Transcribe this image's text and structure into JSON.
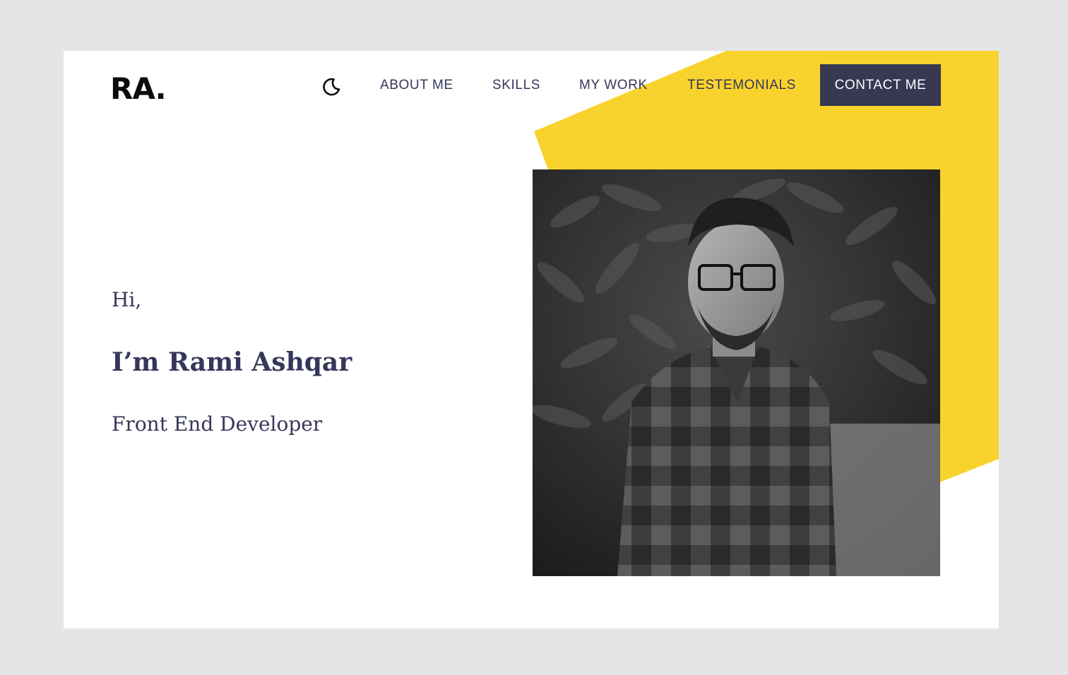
{
  "brand": {
    "logo": "RA."
  },
  "nav": {
    "theme_toggle_icon": "moon-icon",
    "links": [
      "ABOUT ME",
      "SKILLS",
      "MY WORK",
      "TESTEMONIALS"
    ],
    "contact_label": "CONTACT ME"
  },
  "hero": {
    "greeting": "Hi,",
    "name": "I’m Rami Ashqar",
    "role": "Front End Developer"
  },
  "colors": {
    "accent": "#f9d32d",
    "dark": "#373852",
    "text": "#35375a",
    "frame": "#e5e5e5",
    "page": "#ffffff"
  }
}
